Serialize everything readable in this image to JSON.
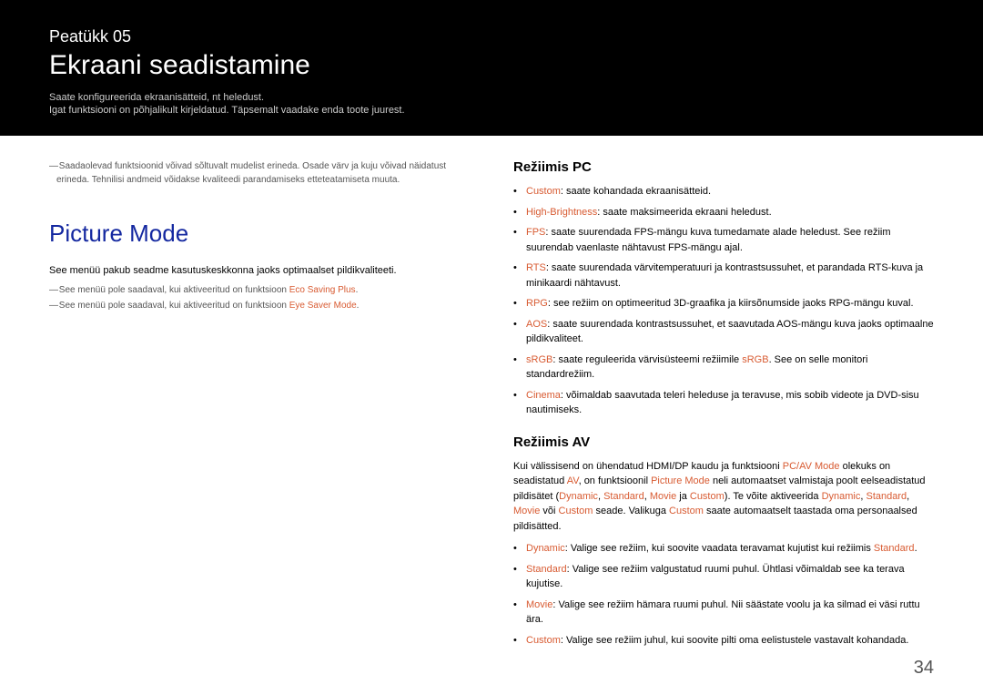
{
  "header": {
    "chapter": "Peatükk 05",
    "title": "Ekraani seadistamine",
    "sub1": "Saate konfigureerida ekraanisätteid, nt heledust.",
    "sub2": "Igat funktsiooni on põhjalikult kirjeldatud. Täpsemalt vaadake enda toote juurest."
  },
  "left": {
    "note1": "Saadaolevad funktsioonid võivad sõltuvalt mudelist erineda. Osade värv ja kuju võivad näidatust erineda. Tehnilisi andmeid võidakse kvaliteedi parandamiseks etteteatamiseta muuta.",
    "section_title": "Picture Mode",
    "body1": "See menüü pakub seadme kasutuskeskkonna jaoks optimaalset pildikvaliteeti.",
    "note2_pre": "See menüü pole saadaval, kui aktiveeritud on funktsioon ",
    "note2_hl": "Eco Saving Plus",
    "note3_pre": "See menüü pole saadaval, kui aktiveeritud on funktsioon ",
    "note3_hl": "Eye Saver Mode"
  },
  "right": {
    "pc_heading": "Režiimis PC",
    "pc_items": [
      {
        "hl": "Custom",
        "txt": ": saate kohandada ekraanisätteid."
      },
      {
        "hl": "High-Brightness",
        "txt": ": saate maksimeerida ekraani heledust."
      },
      {
        "hl": "FPS",
        "txt": ": saate suurendada FPS-mängu kuva tumedamate alade heledust. See režiim suurendab vaenlaste nähtavust FPS-mängu ajal."
      },
      {
        "hl": "RTS",
        "txt": ": saate suurendada värvitemperatuuri ja kontrastsussuhet, et parandada RTS-kuva ja minikaardi nähtavust."
      },
      {
        "hl": "RPG",
        "txt": ": see režiim on optimeeritud 3D-graafika ja kiirsõnumside jaoks RPG-mängu kuval."
      },
      {
        "hl": "AOS",
        "txt": ": saate suurendada kontrastsussuhet, et saavutada AOS-mängu kuva jaoks optimaalne pildikvaliteet."
      },
      {
        "hl": "sRGB",
        "txt_pre": ": saate reguleerida värvisüsteemi režiimile ",
        "hl2": "sRGB",
        "txt_post": ". See on selle monitori standardrežiim."
      },
      {
        "hl": "Cinema",
        "txt": ": võimaldab saavutada teleri heleduse ja teravuse, mis sobib videote ja DVD-sisu nautimiseks."
      }
    ],
    "av_heading": "Režiimis AV",
    "av_para": {
      "p1": "Kui välissisend on ühendatud HDMI/DP kaudu ja funktsiooni ",
      "h1": "PC/AV Mode",
      "p2": " olekuks on seadistatud ",
      "h2": "AV",
      "p3": ", on funktsioonil ",
      "h3": "Picture Mode",
      "p4": " neli automaatset valmistaja poolt eelseadistatud pildisätet (",
      "h4": "Dynamic",
      "p5": ", ",
      "h5": "Standard",
      "p6": ", ",
      "h6": "Movie",
      "p7": " ja ",
      "h7": "Custom",
      "p8": "). Te võite aktiveerida ",
      "h8": "Dynamic",
      "p9": ", ",
      "h9": "Standard",
      "p10": ", ",
      "h10": "Movie",
      "p11": " või ",
      "h11": "Custom",
      "p12": " seade. Valikuga ",
      "h12": "Custom",
      "p13": " saate automaatselt taastada oma personaalsed pildisätted."
    },
    "av_items": [
      {
        "hl": "Dynamic",
        "txt_pre": ": Valige see režiim, kui soovite vaadata teravamat kujutist kui režiimis ",
        "hl2": "Standard",
        "txt_post": "."
      },
      {
        "hl": "Standard",
        "txt": ": Valige see režiim valgustatud ruumi puhul. Ühtlasi võimaldab see ka terava kujutise."
      },
      {
        "hl": "Movie",
        "txt": ": Valige see režiim hämara ruumi puhul. Nii säästate voolu ja ka silmad ei väsi ruttu ära."
      },
      {
        "hl": "Custom",
        "txt": ": Valige see režiim juhul, kui soovite pilti oma eelistustele vastavalt kohandada."
      }
    ]
  },
  "page_number": "34"
}
